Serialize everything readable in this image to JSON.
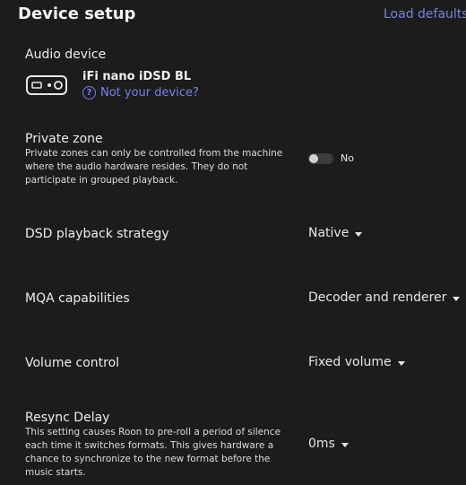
{
  "header": {
    "title": "Device setup",
    "load_defaults": "Load defaults"
  },
  "audio_device": {
    "label": "Audio device",
    "device_name": "iFi nano iDSD BL",
    "not_your_device": "Not your device?",
    "help_glyph": "?"
  },
  "private_zone": {
    "label": "Private zone",
    "description": "Private zones can only be controlled from the machine where the audio hardware resides. They do not participate in grouped playback.",
    "toggle_value": "No",
    "enabled": false
  },
  "dsd_playback": {
    "label": "DSD playback strategy",
    "value": "Native"
  },
  "mqa": {
    "label": "MQA capabilities",
    "value": "Decoder and renderer"
  },
  "volume_control": {
    "label": "Volume control",
    "value": "Fixed volume"
  },
  "resync_delay": {
    "label": "Resync Delay",
    "description": "This setting causes Roon to pre-roll a period of silence each time it switches formats. This gives hardware a chance to synchronize to the new format before the music starts.",
    "value": "0ms"
  },
  "colors": {
    "background": "#1c1c1c",
    "accent": "#7b7ff0",
    "text": "#e6e6e6"
  },
  "icons": {
    "device": "dac-device-icon",
    "help": "help-circle-icon",
    "caret": "caret-down-icon"
  }
}
